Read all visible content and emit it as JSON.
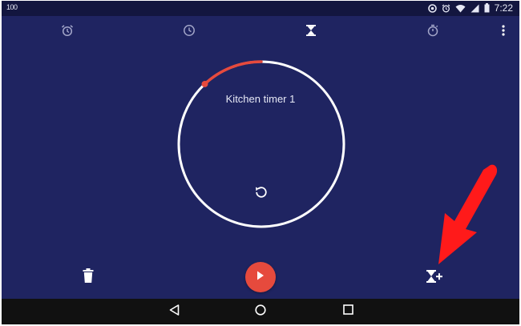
{
  "status_bar": {
    "battery_level": "100",
    "time": "7:22",
    "icons": [
      "sync-icon",
      "alarm-icon",
      "wifi-icon",
      "signal-icon",
      "battery-icon"
    ]
  },
  "tabs": [
    {
      "name": "alarm",
      "icon": "alarm-clock-icon",
      "active": false
    },
    {
      "name": "clock",
      "icon": "clock-icon",
      "active": false
    },
    {
      "name": "timer",
      "icon": "hourglass-icon",
      "active": true
    },
    {
      "name": "stopwatch",
      "icon": "stopwatch-icon",
      "active": false
    }
  ],
  "overflow_menu_icon": "more-vert-icon",
  "timer": {
    "name": "Kitchen timer 1",
    "progress": 0.12,
    "progress_color": "#e64a3d",
    "ring_color": "#ffffff"
  },
  "actions": {
    "delete_icon": "trash-icon",
    "play_icon": "play-icon",
    "add_timer_icon": "add-timer-icon"
  },
  "nav_bar": {
    "buttons": [
      "back-icon",
      "home-icon",
      "recents-icon"
    ]
  },
  "colors": {
    "background": "#1f2461",
    "status_bar": "#13163f",
    "accent": "#e64a3d",
    "annotation_arrow": "#ff1a1a"
  }
}
